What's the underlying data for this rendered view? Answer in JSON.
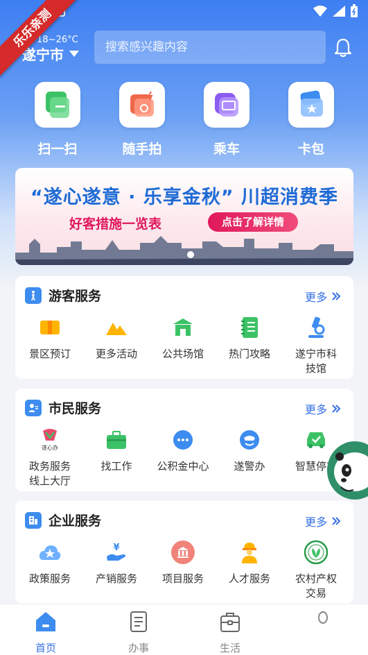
{
  "ribbon": {
    "text": "乐乐亲测"
  },
  "header": {
    "weather": "晴 18~26°C",
    "city": "遂宁市",
    "search_placeholder": "搜索感兴趣内容"
  },
  "quick_actions": [
    {
      "label": "扫一扫",
      "icon": "scan-icon",
      "color": "#3cc266"
    },
    {
      "label": "随手拍",
      "icon": "camera-icon",
      "color": "#f0684a"
    },
    {
      "label": "乘车",
      "icon": "bus-icon",
      "color": "#8a5cf0"
    },
    {
      "label": "卡包",
      "icon": "card-wallet-icon",
      "color": "#3d8cf0"
    }
  ],
  "banner": {
    "title": "“遂心遂意 · 乐享金秋” 川超消费季",
    "subtitle": "好客措施一览表",
    "button": "点击了解详情"
  },
  "sections": [
    {
      "title": "游客服务",
      "more": "更多",
      "items": [
        {
          "label": "景区预订",
          "icon": "ticket-icon"
        },
        {
          "label": "更多活动",
          "icon": "mountain-icon"
        },
        {
          "label": "公共场馆",
          "icon": "venue-icon"
        },
        {
          "label": "热门攻略",
          "icon": "notebook-icon"
        },
        {
          "label": "遂宁市科技馆",
          "icon": "microscope-icon"
        }
      ]
    },
    {
      "title": "市民服务",
      "more": "更多",
      "items": [
        {
          "label": "政务服务线上大厅",
          "icon": "gov-logo-icon"
        },
        {
          "label": "找工作",
          "icon": "briefcase-icon"
        },
        {
          "label": "公积金中心",
          "icon": "chat-dots-icon"
        },
        {
          "label": "遂警办",
          "icon": "police-icon"
        },
        {
          "label": "智慧停车",
          "icon": "car-icon"
        }
      ]
    },
    {
      "title": "企业服务",
      "more": "更多",
      "items": [
        {
          "label": "政策服务",
          "icon": "cloud-star-icon"
        },
        {
          "label": "产销服务",
          "icon": "yuan-hand-icon"
        },
        {
          "label": "项目服务",
          "icon": "bank-icon"
        },
        {
          "label": "人才服务",
          "icon": "worker-icon"
        },
        {
          "label": "农村产权交易",
          "icon": "leaf-seal-icon"
        }
      ]
    }
  ],
  "tabbar": [
    {
      "label": "首页",
      "icon": "home-icon",
      "active": true
    },
    {
      "label": "办事",
      "icon": "document-icon",
      "active": false
    },
    {
      "label": "生活",
      "icon": "bag-icon",
      "active": false
    },
    {
      "label": "",
      "icon": "profile-icon",
      "active": false
    }
  ],
  "colors": {
    "accent": "#3570e6",
    "banner_title": "#1e6bd6",
    "banner_pink": "#e0185b"
  }
}
